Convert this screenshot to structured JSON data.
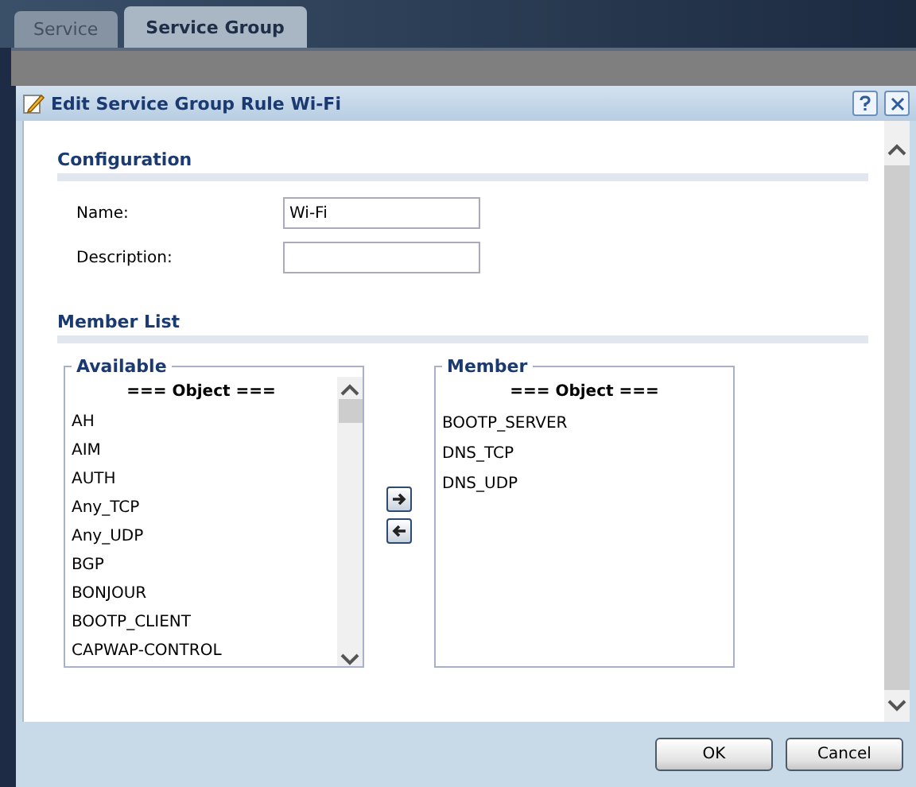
{
  "tabs": [
    {
      "label": "Service",
      "selected": false
    },
    {
      "label": "Service Group",
      "selected": true
    }
  ],
  "dialog": {
    "title": "Edit Service Group Rule Wi-Fi",
    "configuration": {
      "heading": "Configuration",
      "fields": [
        {
          "label": "Name:",
          "value": "Wi-Fi"
        },
        {
          "label": "Description:"
        }
      ]
    },
    "member_list": {
      "heading": "Member List",
      "available": {
        "legend": "Available",
        "header": "=== Object ===",
        "items": [
          "AH",
          "AIM",
          "AUTH",
          "Any_TCP",
          "Any_UDP",
          "BGP",
          "BONJOUR",
          "BOOTP_CLIENT",
          "CAPWAP-CONTROL"
        ]
      },
      "member": {
        "legend": "Member",
        "header": "=== Object ===",
        "items": [
          "BOOTP_SERVER",
          "DNS_TCP",
          "DNS_UDP"
        ]
      }
    },
    "buttons": [
      "OK",
      "Cancel"
    ]
  }
}
